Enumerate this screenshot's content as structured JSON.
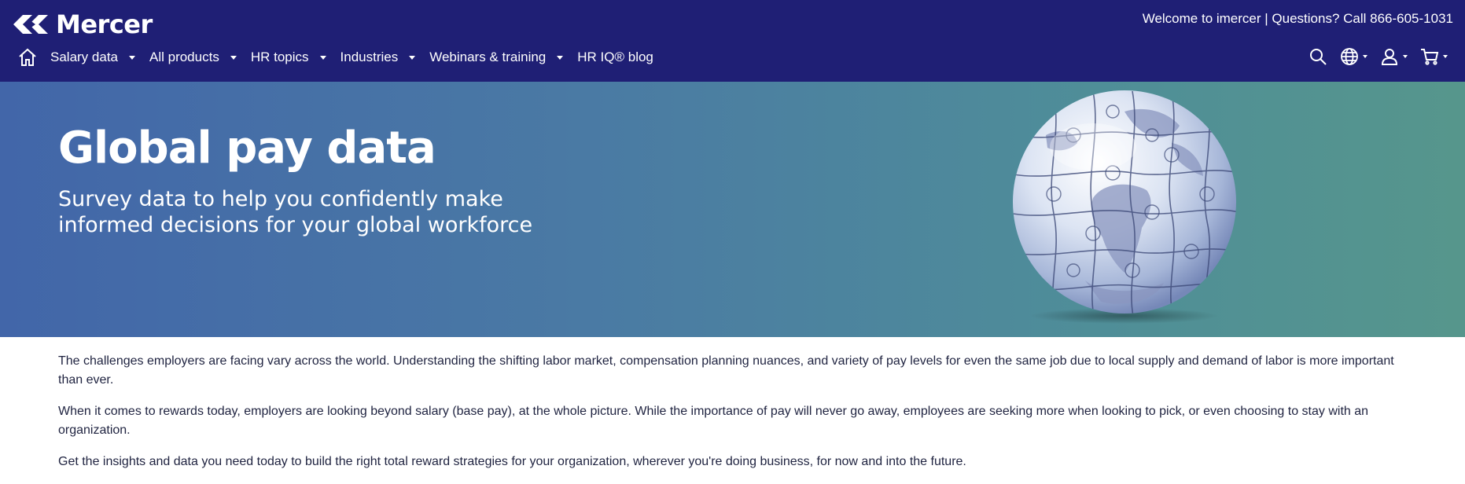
{
  "header": {
    "brand": "Mercer",
    "welcome": "Welcome to imercer | Questions? Call 866-605-1031"
  },
  "nav": {
    "home_icon": "home-icon",
    "items": [
      {
        "label": "Salary data",
        "has_dropdown": true
      },
      {
        "label": "All products",
        "has_dropdown": true
      },
      {
        "label": "HR topics",
        "has_dropdown": true
      },
      {
        "label": "Industries",
        "has_dropdown": true
      },
      {
        "label": "Webinars & training",
        "has_dropdown": true
      },
      {
        "label": "HR IQ® blog",
        "has_dropdown": false
      }
    ],
    "utilities": [
      {
        "icon": "search-icon"
      },
      {
        "icon": "globe-icon",
        "has_dropdown": true
      },
      {
        "icon": "user-icon",
        "has_dropdown": true
      },
      {
        "icon": "cart-icon",
        "has_dropdown": true
      }
    ]
  },
  "hero": {
    "title": "Global pay data",
    "subtitle": "Survey data to help you confidently make informed decisions for your global workforce",
    "image_icon": "puzzle-globe-image"
  },
  "content": {
    "paragraphs": [
      "The challenges employers are facing vary across the world. Understanding the shifting labor market, compensation planning nuances, and variety of pay levels for even the same job due to local supply and demand of labor is more important than ever.",
      "When it comes to rewards today, employers are looking beyond salary (base pay), at the whole picture. While the importance of pay will never go away, employees are seeking more when looking to pick, or even choosing to stay with an organization.",
      "Get the insights and data you need today to build the right total reward strategies for your organization, wherever you're doing business, for now and into the future."
    ]
  },
  "colors": {
    "header_bg": "#1f1f75",
    "hero_gradient_start": "#4266a9",
    "hero_gradient_end": "#56968c",
    "body_text": "#1f2340"
  }
}
